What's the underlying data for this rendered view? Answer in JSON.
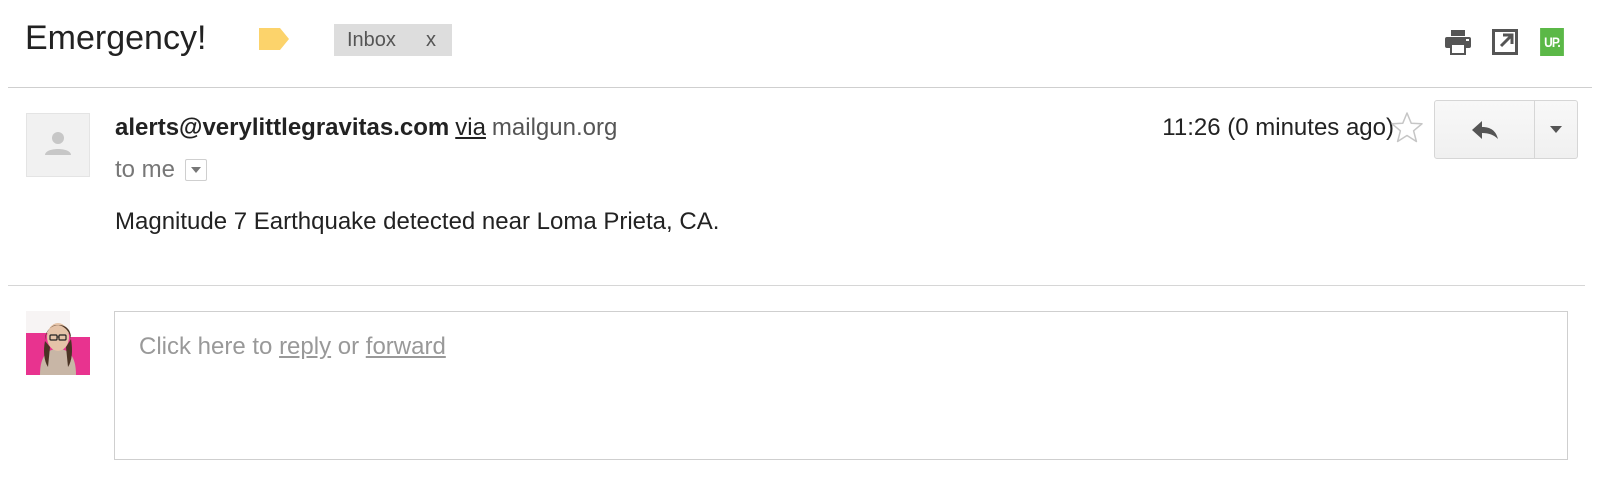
{
  "header": {
    "subject": "Emergency!",
    "important_marker_color": "#fcd36b",
    "label": {
      "text": "Inbox",
      "remove": "x"
    },
    "tools": [
      "print-icon",
      "open-new-window-icon",
      "up-extension-icon"
    ],
    "up_badge_text": "UP.",
    "up_badge_color": "#5bb847"
  },
  "message": {
    "sender_email": "alerts@verylittlegravitas.com",
    "via_label": "via",
    "via_domain": "mailgun.org",
    "recipient": "to me",
    "timestamp": "11:26 (0 minutes ago)",
    "body": "Magnitude 7 Earthquake detected near Loma Prieta, CA.",
    "icons": {
      "star": "star-icon",
      "reply": "reply-arrow-icon",
      "more": "caret-down-icon"
    }
  },
  "reply_area": {
    "prompt_start": "Click here to",
    "reply_link": "reply",
    "or": "or",
    "forward_link": "forward"
  }
}
